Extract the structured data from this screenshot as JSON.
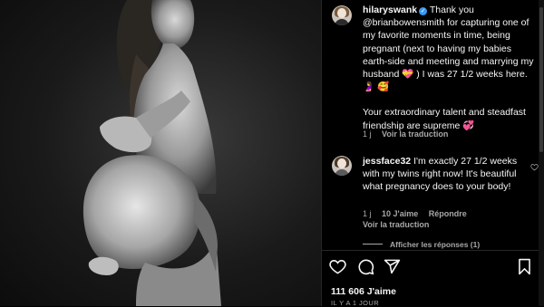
{
  "post": {
    "author": "hilaryswank",
    "verified_mark": "✓",
    "caption_text": "Thank you @brianbowensmith for capturing one of my favorite moments in time, being pregnant (next to having my babies earth-side and meeting and marrying my husband 💝 ) I was 27 1/2 weeks here. 🤰 🥰",
    "caption_text2": "Your extraordinary talent and steadfast friendship are supreme 💞",
    "caption_age": "1 j",
    "caption_translate": "Voir la traduction"
  },
  "comments": [
    {
      "username": "jessface32",
      "text": "I'm exactly 27 1/2 weeks with my twins right now! It's beautiful what pregnancy does to your body!",
      "age": "1 j",
      "likes": "10 J'aime",
      "reply": "Répondre",
      "translate": "Voir la traduction"
    }
  ],
  "replies_toggle": "Afficher les réponses (1)",
  "footer": {
    "likes": "111 606 J'aime",
    "date": "IL Y A 1 JOUR"
  },
  "icons": {
    "like": "heart-outline-icon",
    "comment": "comment-bubble-icon",
    "share": "paper-plane-icon",
    "save": "bookmark-icon"
  },
  "colors": {
    "background": "#000000",
    "text": "#f5f5f5",
    "muted": "#a8a8a8",
    "verified": "#3897f0"
  }
}
